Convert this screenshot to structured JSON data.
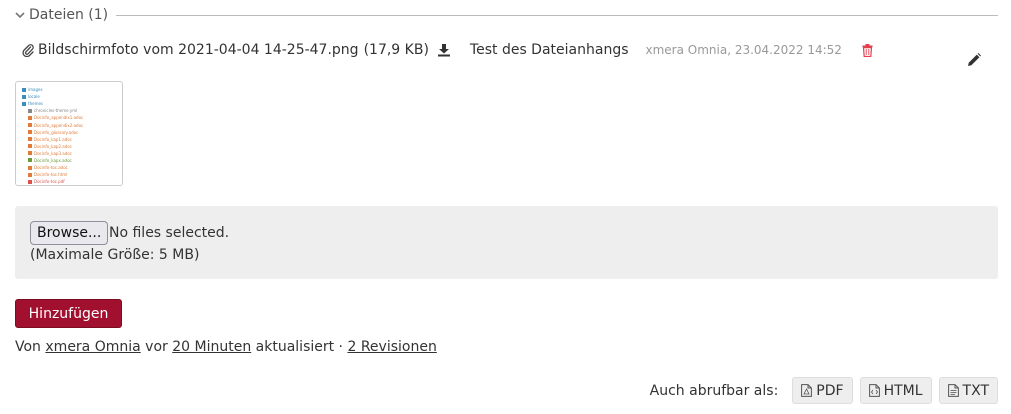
{
  "section": {
    "title": "Dateien (1)"
  },
  "attachment": {
    "filename": "Bildschirmfoto vom 2021-04-04 14-25-47.png",
    "size": "(17,9 KB)",
    "description": "Test des Dateianhangs",
    "author_date": "xmera Omnia, 23.04.2022 14:52"
  },
  "thumbnail": {
    "lines": [
      {
        "text": "images",
        "kind": "folder"
      },
      {
        "text": "locale",
        "kind": "folder"
      },
      {
        "text": "themes",
        "kind": "folder"
      },
      {
        "text": "chronicles-theme.yml",
        "kind": "config"
      },
      {
        "text": "Docinfo_appendix1.adoc",
        "kind": "adoc"
      },
      {
        "text": "Docinfo_appendix2.adoc",
        "kind": "adoc"
      },
      {
        "text": "Docinfo_glossary.adoc",
        "kind": "adoc"
      },
      {
        "text": "Docinfo_kap1.adoc",
        "kind": "adoc"
      },
      {
        "text": "Docinfo_kap2.adoc",
        "kind": "adoc"
      },
      {
        "text": "Docinfo_kap3.adoc",
        "kind": "adoc"
      },
      {
        "text": "Docinfo_kapx.adoc",
        "kind": "adoc-green"
      },
      {
        "text": "Docinfo-toc.adoc",
        "kind": "adoc"
      },
      {
        "text": "Docinfo-toc.html",
        "kind": "html"
      },
      {
        "text": "Docinfo-toc.pdf",
        "kind": "pdf"
      }
    ]
  },
  "upload": {
    "browse_label": "Browse...",
    "no_file_text": "No files selected.",
    "max_size": "(Maximale Größe: 5 MB)"
  },
  "submit_label": "Hinzufügen",
  "updated": {
    "prefix": "Von",
    "author": "xmera Omnia",
    "middle": "vor",
    "time": "20 Minuten",
    "suffix": "aktualisiert ·",
    "revisions": "2 Revisionen"
  },
  "export": {
    "label": "Auch abrufbar als:",
    "formats": [
      "PDF",
      "HTML",
      "TXT"
    ]
  },
  "colors": {
    "accent": "#a1102e",
    "delete": "#e0404f",
    "folder": "#3c8dbc",
    "adoc": "#e07b39",
    "adoc_green": "#6a9a3a",
    "pdf": "#d9534f"
  },
  "icons": [
    "chevron-down-icon",
    "paperclip-icon",
    "download-icon",
    "trash-icon",
    "pencil-icon",
    "pdf-file-icon",
    "html-file-icon",
    "txt-file-icon"
  ]
}
